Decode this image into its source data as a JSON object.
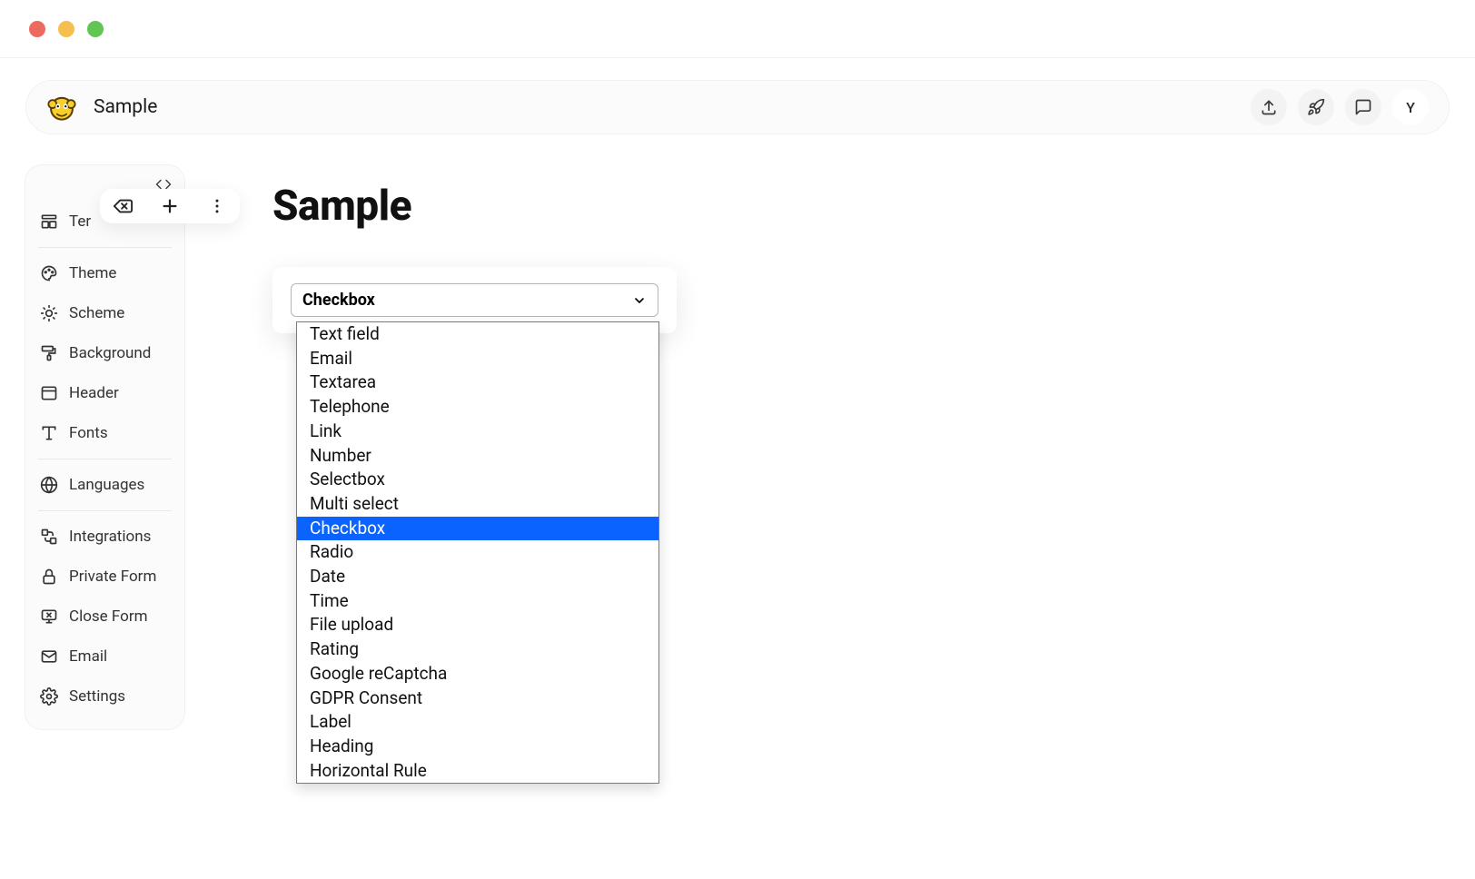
{
  "header": {
    "title": "Sample",
    "avatar_initial": "Y"
  },
  "sidebar": {
    "items": [
      {
        "icon": "template",
        "label": "Ter"
      },
      {
        "icon": "theme",
        "label": "Theme"
      },
      {
        "icon": "scheme",
        "label": "Scheme"
      },
      {
        "icon": "background",
        "label": "Background"
      },
      {
        "icon": "header",
        "label": "Header"
      },
      {
        "icon": "fonts",
        "label": "Fonts"
      },
      {
        "icon": "languages",
        "label": "Languages"
      },
      {
        "icon": "integrations",
        "label": "Integrations"
      },
      {
        "icon": "private-form",
        "label": "Private Form"
      },
      {
        "icon": "close-form",
        "label": "Close Form"
      },
      {
        "icon": "email",
        "label": "Email"
      },
      {
        "icon": "settings",
        "label": "Settings"
      }
    ]
  },
  "canvas": {
    "heading": "Sample",
    "select": {
      "selected": "Checkbox",
      "options": [
        "Text field",
        "Email",
        "Textarea",
        "Telephone",
        "Link",
        "Number",
        "Selectbox",
        "Multi select",
        "Checkbox",
        "Radio",
        "Date",
        "Time",
        "File upload",
        "Rating",
        "Google reCaptcha",
        "GDPR Consent",
        "Label",
        "Heading",
        "Horizontal Rule"
      ]
    }
  }
}
